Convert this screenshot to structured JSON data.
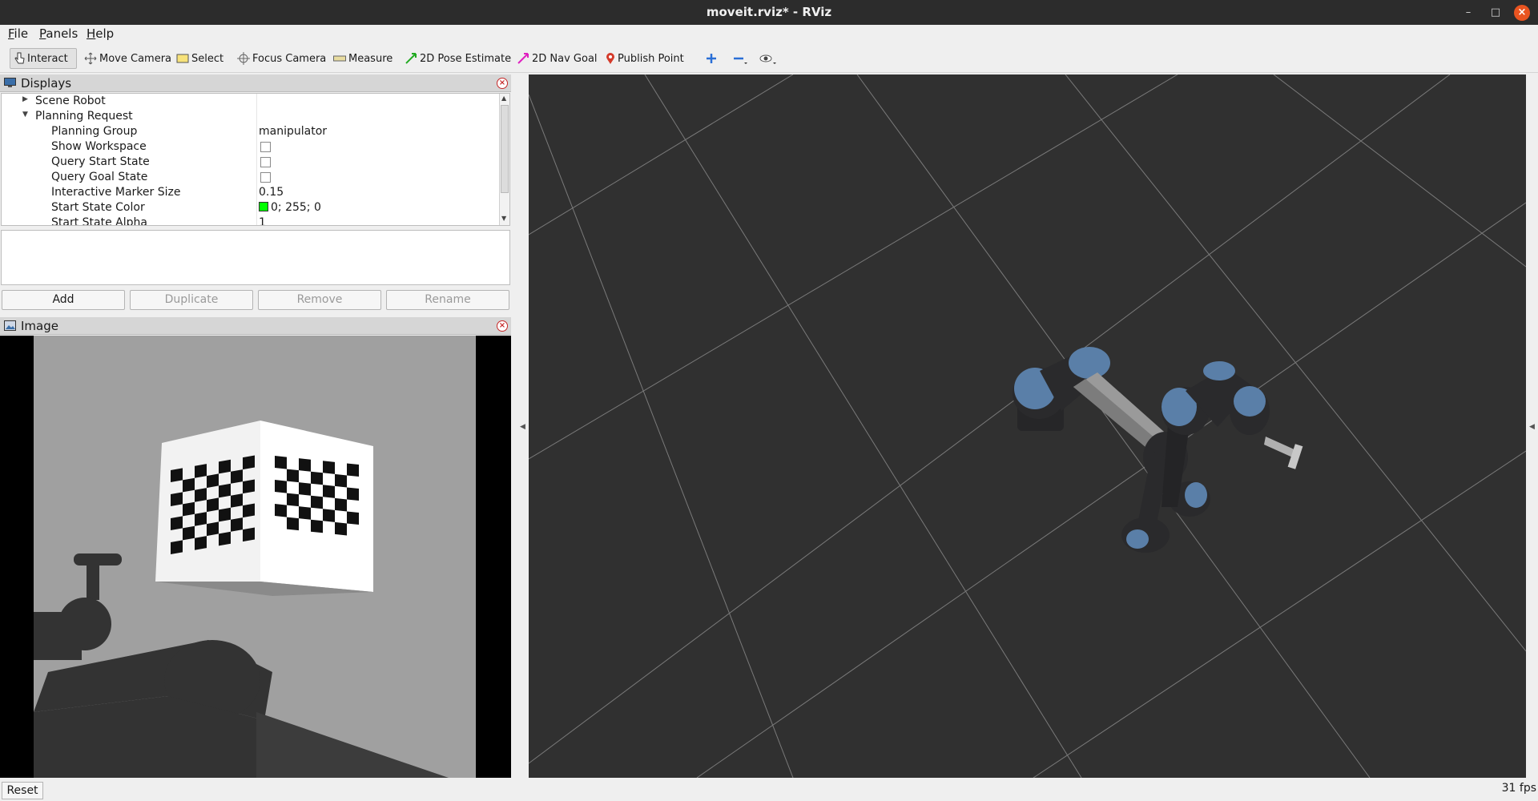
{
  "window": {
    "title": "moveit.rviz* - RViz"
  },
  "menubar": {
    "items": [
      {
        "accel": "F",
        "rest": "ile"
      },
      {
        "accel": "P",
        "rest": "anels"
      },
      {
        "accel": "H",
        "rest": "elp"
      }
    ]
  },
  "toolbar": {
    "interact": "Interact",
    "move_camera": "Move Camera",
    "select": "Select",
    "focus_camera": "Focus Camera",
    "measure": "Measure",
    "pose_estimate": "2D Pose Estimate",
    "nav_goal": "2D Nav Goal",
    "publish_point": "Publish Point"
  },
  "displays_panel": {
    "title": "Displays",
    "rows": [
      {
        "label": "Scene Robot",
        "value": "",
        "level": 1,
        "expander": "collapsed",
        "checkbox": false
      },
      {
        "label": "Planning Request",
        "value": "",
        "level": 1,
        "expander": "expanded",
        "checkbox": false
      },
      {
        "label": "Planning Group",
        "value": "manipulator",
        "level": 2,
        "checkbox": false
      },
      {
        "label": "Show Workspace",
        "value": "",
        "level": 2,
        "checkbox": true,
        "checked": false
      },
      {
        "label": "Query Start State",
        "value": "",
        "level": 2,
        "checkbox": true,
        "checked": false
      },
      {
        "label": "Query Goal State",
        "value": "",
        "level": 2,
        "checkbox": true,
        "checked": false
      },
      {
        "label": "Interactive Marker Size",
        "value": "0.15",
        "level": 2,
        "checkbox": false
      },
      {
        "label": "Start State Color",
        "value": "0; 255; 0",
        "level": 2,
        "checkbox": false,
        "swatch": "#00ff00"
      },
      {
        "label": "Start State Alpha",
        "value": "1",
        "level": 2,
        "checkbox": false
      }
    ],
    "buttons": {
      "add": "Add",
      "duplicate": "Duplicate",
      "remove": "Remove",
      "rename": "Rename"
    }
  },
  "image_panel": {
    "title": "Image"
  },
  "statusbar": {
    "reset": "Reset",
    "fps": "31 fps"
  },
  "colors": {
    "viewport_bg": "#303030",
    "grid": "#7a7a7a",
    "robot_dark": "#2a2a2c",
    "robot_cap": "#5a7fa8",
    "robot_link": "#9a9a9a",
    "camera_bg": "#a0a0a0"
  }
}
